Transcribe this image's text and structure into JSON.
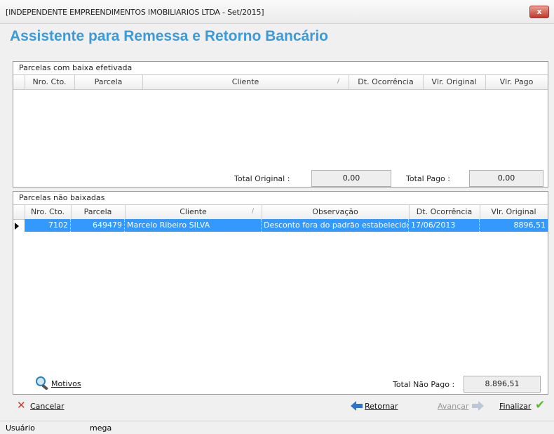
{
  "window": {
    "title": "[INDEPENDENTE EMPREENDIMENTOS IMOBILIARIOS LTDA - Set/2015]",
    "close_label": "x"
  },
  "heading": "Assistente para Remessa e Retorno Bancário",
  "baixa_efetivada": {
    "caption": "Parcelas com baixa efetivada",
    "columns": [
      "Nro. Cto.",
      "Parcela",
      "Cliente",
      "Dt. Ocorrência",
      "Vlr. Original",
      "Vlr. Pago"
    ],
    "total_original_label": "Total Original :",
    "total_original_value": "0,00",
    "total_pago_label": "Total Pago :",
    "total_pago_value": "0,00"
  },
  "nao_baixadas": {
    "caption": "Parcelas não baixadas",
    "columns": [
      "Nro. Cto.",
      "Parcela",
      "Cliente",
      "Observação",
      "Dt. Ocorrência",
      "Vlr. Original"
    ],
    "rows": [
      {
        "nro_cto": "7102",
        "parcela": "649479",
        "cliente": "Marcelo Ribeiro SILVA",
        "observacao": "Desconto fora do padrão estabelecido",
        "dt_ocorrencia": "17/06/2013",
        "vlr_original": "8896,51"
      }
    ],
    "motivos_label": "Motivos",
    "total_nao_pago_label": "Total Não Pago :",
    "total_nao_pago_value": "8.896,51"
  },
  "footer": {
    "cancelar": "Cancelar",
    "retornar": "Retornar",
    "avancar": "Avançar",
    "finalizar": "Finalizar"
  },
  "status": {
    "user_label": "Usuário",
    "user_value": "mega"
  },
  "colors": {
    "heading": "#3d9ad8",
    "selection": "#3399ff"
  }
}
